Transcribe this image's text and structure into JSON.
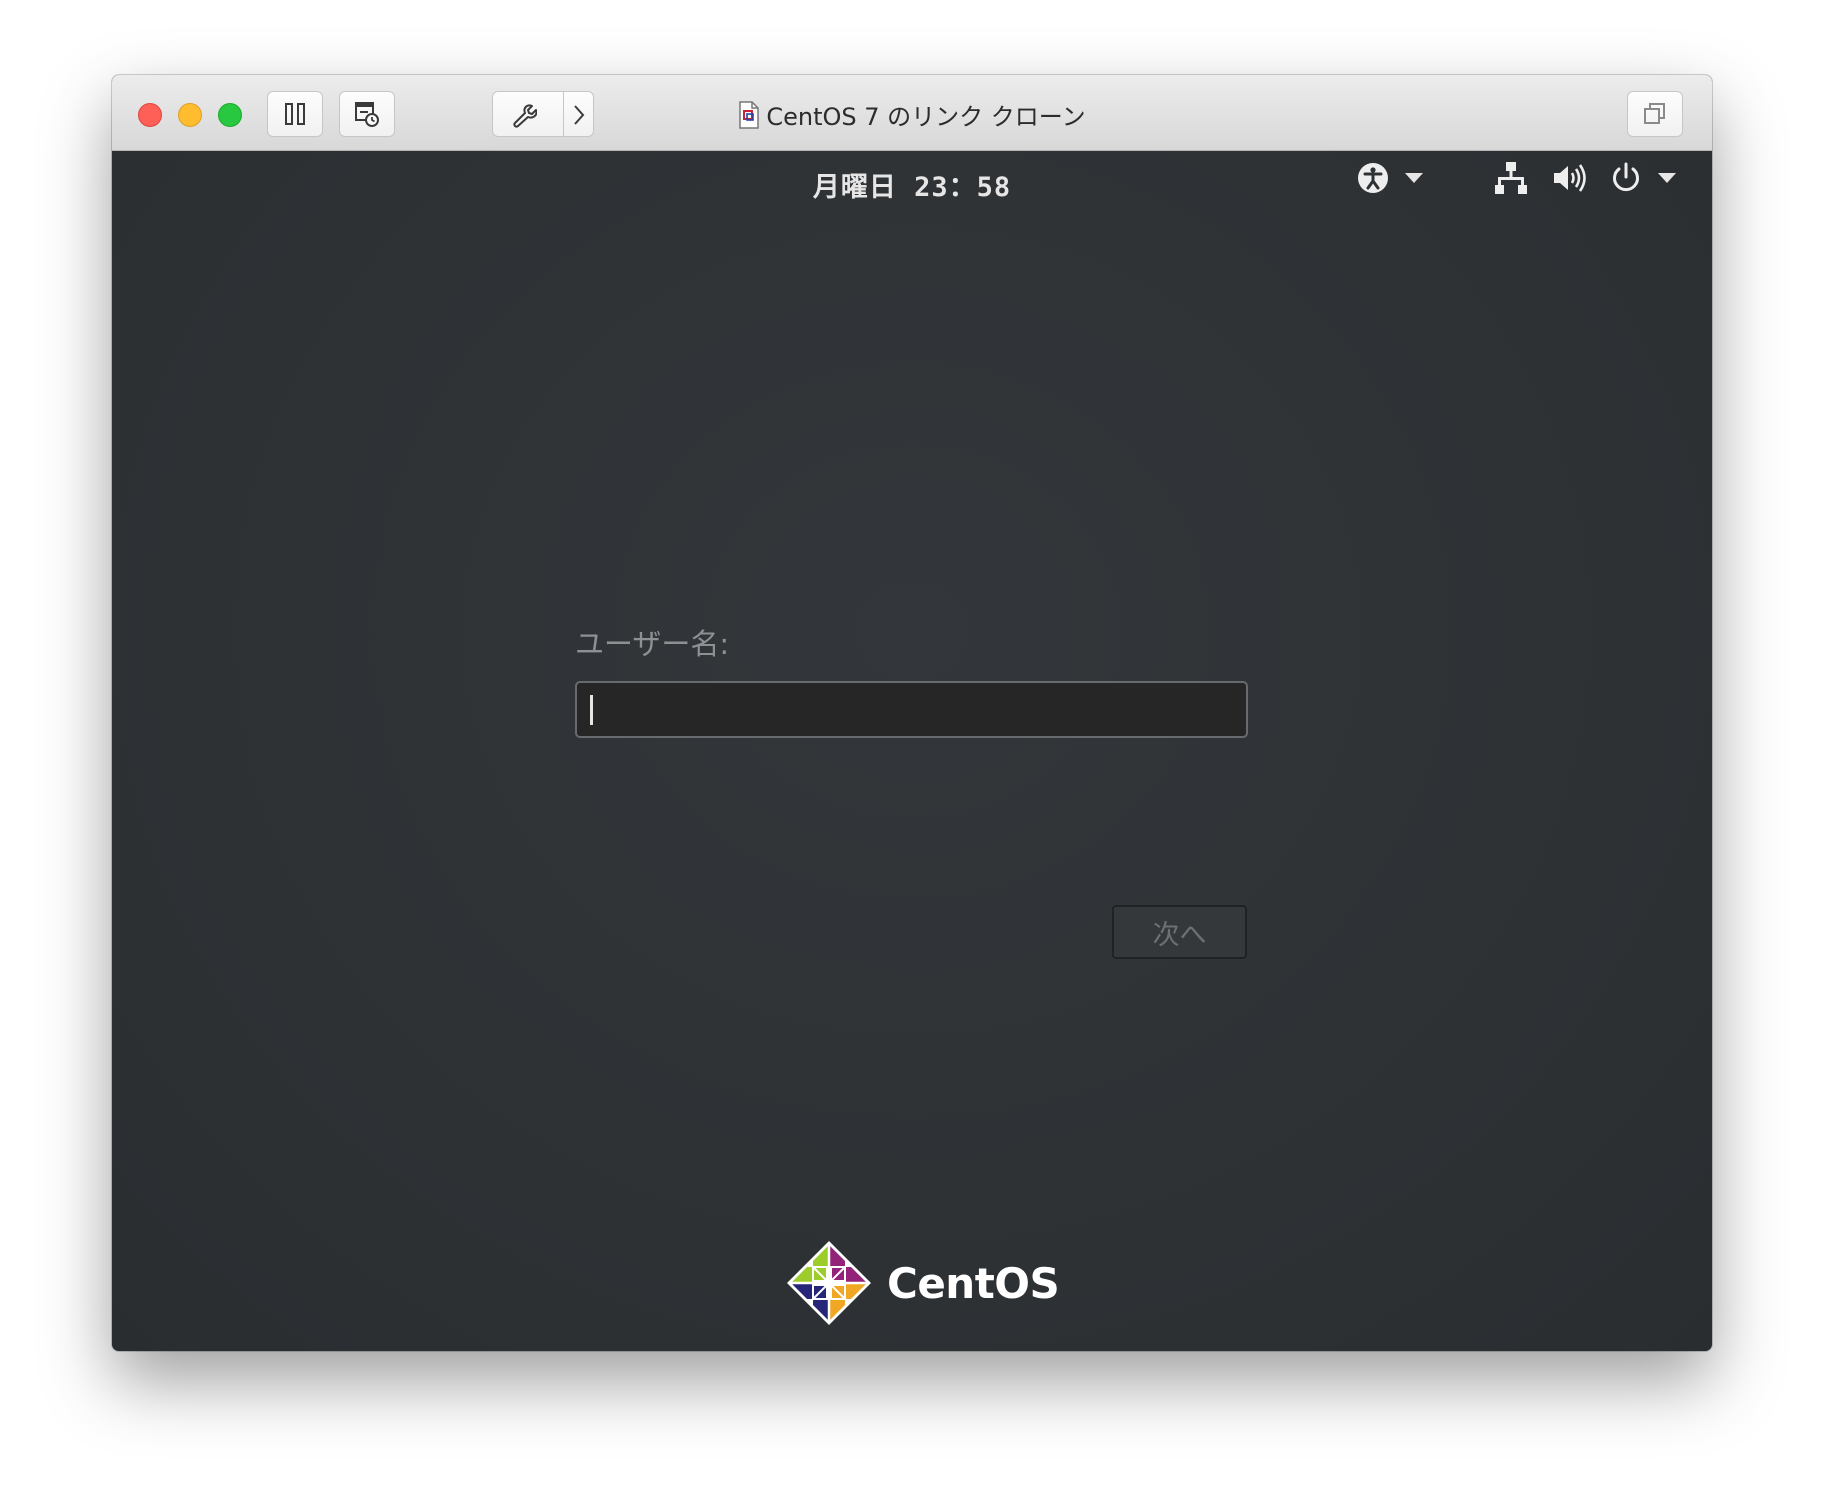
{
  "window": {
    "title": "CentOS 7 のリンク クローン"
  },
  "toolbar": {
    "icons": [
      "pause-icon",
      "snapshot-icon",
      "wrench-icon",
      "chevron-right-icon",
      "fullscreen-icon"
    ]
  },
  "top_panel": {
    "clock": "月曜日 23：58",
    "tray_icons": [
      "accessibility-icon",
      "network-icon",
      "volume-icon",
      "power-icon"
    ]
  },
  "login": {
    "username_label": "ユーザー名:",
    "username_value": "",
    "next_button": "次へ"
  },
  "branding": {
    "name": "CentOS"
  },
  "colors": {
    "screen_background": "#2e3235",
    "input_background": "#262626",
    "close": "#fe5f57",
    "minimize": "#febc2e",
    "maximize": "#28c840"
  }
}
